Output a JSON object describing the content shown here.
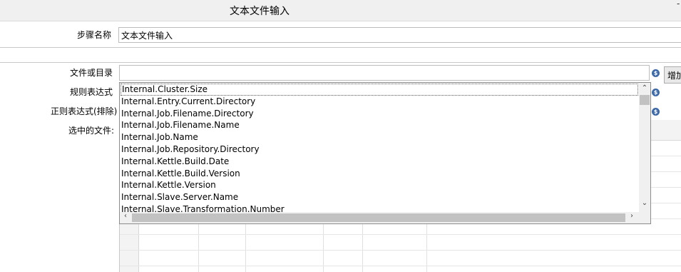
{
  "window": {
    "title": "文本文件输入",
    "minimize_glyph": "-"
  },
  "form": {
    "step_name_label": "步骤名称",
    "step_name_value": "文本文件输入",
    "file_or_dir_label": "文件或目录",
    "file_or_dir_value": "",
    "regex_label": "规则表达式",
    "regex_exclude_label": "正则表达式(排除)",
    "selected_files_label": "选中的文件:",
    "add_button_label": "增加",
    "variable_icon_glyph": "$"
  },
  "dropdown": {
    "items": [
      "Internal.Cluster.Size",
      "Internal.Entry.Current.Directory",
      "Internal.Job.Filename.Directory",
      "Internal.Job.Filename.Name",
      "Internal.Job.Name",
      "Internal.Job.Repository.Directory",
      "Internal.Kettle.Build.Date",
      "Internal.Kettle.Build.Version",
      "Internal.Kettle.Version",
      "Internal.Slave.Server.Name",
      "Internal.Slave.Transformation.Number"
    ],
    "selected_index": 0,
    "arrows": {
      "up": "⌃",
      "down": "⌄",
      "left": "‹",
      "right": "›"
    }
  },
  "icons": {
    "variable": "dollar-variable-icon",
    "scroll_up": "chevron-up-icon",
    "scroll_down": "chevron-down-icon",
    "scroll_left": "chevron-left-icon",
    "scroll_right": "chevron-right-icon"
  },
  "colors": {
    "variable_icon": "#3d6aa6",
    "titlebar": "#f0f0f0"
  }
}
